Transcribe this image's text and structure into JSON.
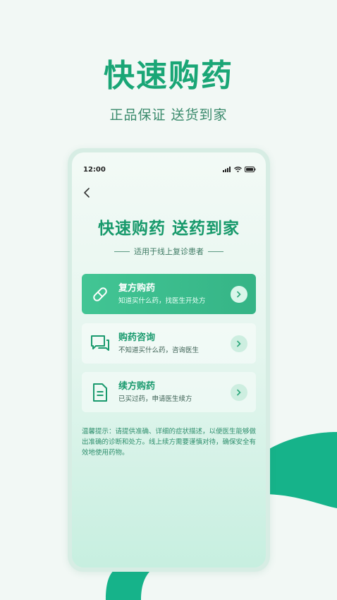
{
  "promo": {
    "title": "快速购药",
    "subtitle": "正品保证  送货到家"
  },
  "status_bar": {
    "time": "12:00"
  },
  "screen": {
    "title": "快速购药  送药到家",
    "subtitle": "适用于线上复诊患者"
  },
  "options": [
    {
      "title": "复方购药",
      "desc": "知道买什么药，找医生开处方",
      "icon": "pill-icon",
      "active": true
    },
    {
      "title": "购药咨询",
      "desc": "不知道买什么药，咨询医生",
      "icon": "chat-icon",
      "active": false
    },
    {
      "title": "续方购药",
      "desc": "已买过药，申请医生续方",
      "icon": "document-icon",
      "active": false
    }
  ],
  "tip": "温馨提示：请提供准确、详细的症状描述，以便医生能够做出准确的诊断和处方。线上续方需要谨慎对待，确保安全有效地使用药物。",
  "colors": {
    "brand": "#1aa676",
    "active_card": "#3bbd8c",
    "background": "#f2f8f5"
  }
}
